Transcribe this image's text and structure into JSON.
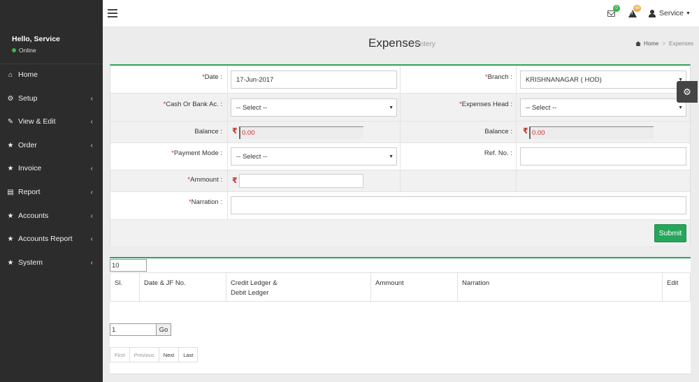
{
  "sidebar": {
    "greeting": "Hello, Service",
    "status": "Online",
    "items": [
      {
        "label": "Home",
        "icon": "home-icon"
      },
      {
        "label": "Setup",
        "icon": "cogs-icon"
      },
      {
        "label": "View & Edit",
        "icon": "edit-icon"
      },
      {
        "label": "Order",
        "icon": "star-icon"
      },
      {
        "label": "Invoice",
        "icon": "star-icon"
      },
      {
        "label": "Report",
        "icon": "file-icon"
      },
      {
        "label": "Accounts",
        "icon": "star-icon"
      },
      {
        "label": "Accounts Report",
        "icon": "star-icon"
      },
      {
        "label": "System",
        "icon": "star-icon"
      }
    ]
  },
  "topbar": {
    "mail_count": "0",
    "alert_count": "48",
    "user_name": "Service"
  },
  "header": {
    "title": "Expenses",
    "subtitle": "Entery",
    "breadcrumb_home": "Home",
    "breadcrumb_current": "Expenses"
  },
  "form": {
    "date_label": "Date :",
    "date_value": "17-Jun-2017",
    "branch_label": "Branch :",
    "branch_value": "KRISHNANAGAR ( HOD)",
    "cash_label": "Cash Or Bank Ac. :",
    "cash_value": "-- Select --",
    "exp_head_label": "Expenses Head :",
    "exp_head_value": "-- Select --",
    "balance_label_left": "Balance :",
    "balance_value_left": "0.00",
    "balance_label_right": "Balance :",
    "balance_value_right": "0.00",
    "payment_label": "Payment Mode :",
    "payment_value": "-- Select --",
    "ref_label": "Ref. No. :",
    "ref_value": "",
    "amount_label": "Ammount :",
    "amount_value": "",
    "narration_label": "Narration :",
    "narration_value": "",
    "submit_label": "Submit",
    "required_mark": "*",
    "currency_symbol": "₹"
  },
  "table": {
    "page_size": "10",
    "columns": [
      "Sl.",
      "Date & JF No.",
      "Credit Ledger &",
      "Debit Ledger",
      "Ammount",
      "Narration",
      "Edit"
    ],
    "page_no": "1",
    "go_label": "Go",
    "pager": [
      "First",
      "Previous",
      "Next",
      "Last"
    ]
  },
  "colors": {
    "sidebar_bg": "#2c2c2c",
    "accent_green": "#26a65b",
    "required_red": "#c9302c"
  }
}
